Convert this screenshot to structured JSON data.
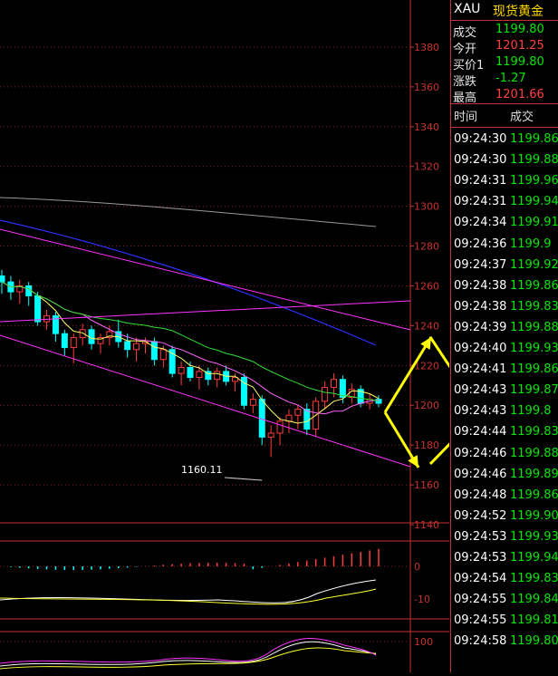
{
  "header": {
    "symbol": "XAU",
    "name": "现货黄金"
  },
  "quote": [
    {
      "label": "成交",
      "value": "1199.80",
      "color": "#00e600"
    },
    {
      "label": "今开",
      "value": "1201.25",
      "color": "#ff4040"
    },
    {
      "label": "买价1",
      "value": "1199.80",
      "color": "#00e600"
    },
    {
      "label": "涨跌",
      "value": "-1.27",
      "color": "#00e600"
    },
    {
      "label": "最高",
      "value": "1201.66",
      "color": "#ff4040"
    }
  ],
  "ticks_header": {
    "time": "时间",
    "price": "成交"
  },
  "ticks": [
    {
      "time": "09:24:30",
      "price": "1199.86"
    },
    {
      "time": "09:24:30",
      "price": "1199.88"
    },
    {
      "time": "09:24:31",
      "price": "1199.96"
    },
    {
      "time": "09:24:31",
      "price": "1199.94"
    },
    {
      "time": "09:24:34",
      "price": "1199.91"
    },
    {
      "time": "09:24:36",
      "price": "1199.9"
    },
    {
      "time": "09:24:37",
      "price": "1199.92"
    },
    {
      "time": "09:24:38",
      "price": "1199.86"
    },
    {
      "time": "09:24:38",
      "price": "1199.83"
    },
    {
      "time": "09:24:39",
      "price": "1199.88"
    },
    {
      "time": "09:24:40",
      "price": "1199.93"
    },
    {
      "time": "09:24:41",
      "price": "1199.86"
    },
    {
      "time": "09:24:43",
      "price": "1199.87"
    },
    {
      "time": "09:24:43",
      "price": "1199.8"
    },
    {
      "time": "09:24:44",
      "price": "1199.83"
    },
    {
      "time": "09:24:46",
      "price": "1199.88"
    },
    {
      "time": "09:24:46",
      "price": "1199.89"
    },
    {
      "time": "09:24:48",
      "price": "1199.86"
    },
    {
      "time": "09:24:52",
      "price": "1199.90"
    },
    {
      "time": "09:24:53",
      "price": "1199.93"
    },
    {
      "time": "09:24:53",
      "price": "1199.94"
    },
    {
      "time": "09:24:54",
      "price": "1199.83"
    },
    {
      "time": "09:24:55",
      "price": "1199.84"
    },
    {
      "time": "09:24:55",
      "price": "1199.81"
    },
    {
      "time": "09:24:58",
      "price": "1199.80"
    }
  ],
  "chart_data": {
    "type": "candlestick",
    "y_axis_labels": [
      "1380",
      "1360",
      "1340",
      "1320",
      "1300",
      "1280",
      "1260",
      "1240",
      "1220",
      "1200",
      "1180",
      "1160",
      "1140"
    ],
    "ylim": [
      1140,
      1390
    ],
    "low_annotation": "1160.11",
    "macd_axis_labels": [
      "0",
      "-10"
    ],
    "kdj_axis_labels": [
      "100"
    ],
    "colors": {
      "up": "#ff3c3c",
      "down": "#00ffff",
      "axis": "#c83232",
      "arrow": "#ffff00"
    },
    "candles": [
      [
        1265,
        1268,
        1256,
        1262
      ],
      [
        1262,
        1265,
        1253,
        1257
      ],
      [
        1257,
        1263,
        1251,
        1260
      ],
      [
        1260,
        1262,
        1250,
        1255
      ],
      [
        1255,
        1257,
        1240,
        1242
      ],
      [
        1242,
        1248,
        1238,
        1245
      ],
      [
        1245,
        1247,
        1232,
        1236
      ],
      [
        1236,
        1238,
        1225,
        1229
      ],
      [
        1229,
        1236,
        1221,
        1234
      ],
      [
        1234,
        1241,
        1230,
        1238
      ],
      [
        1238,
        1240,
        1228,
        1231
      ],
      [
        1231,
        1236,
        1226,
        1234
      ],
      [
        1234,
        1240,
        1230,
        1237
      ],
      [
        1237,
        1243,
        1229,
        1232
      ],
      [
        1232,
        1236,
        1224,
        1228
      ],
      [
        1228,
        1234,
        1222,
        1231
      ],
      [
        1231,
        1234,
        1226,
        1232
      ],
      [
        1232,
        1234,
        1220,
        1223
      ],
      [
        1223,
        1230,
        1219,
        1228
      ],
      [
        1228,
        1230,
        1214,
        1216
      ],
      [
        1216,
        1222,
        1210,
        1219
      ],
      [
        1219,
        1222,
        1212,
        1214
      ],
      [
        1214,
        1220,
        1208,
        1217
      ],
      [
        1217,
        1219,
        1210,
        1213
      ],
      [
        1213,
        1219,
        1209,
        1217
      ],
      [
        1217,
        1220,
        1210,
        1212
      ],
      [
        1212,
        1216,
        1207,
        1214
      ],
      [
        1214,
        1216,
        1198,
        1200
      ],
      [
        1200,
        1206,
        1196,
        1203
      ],
      [
        1203,
        1205,
        1180,
        1184
      ],
      [
        1184,
        1190,
        1174,
        1186
      ],
      [
        1186,
        1194,
        1180,
        1192
      ],
      [
        1192,
        1198,
        1186,
        1195
      ],
      [
        1195,
        1200,
        1188,
        1198
      ],
      [
        1198,
        1201,
        1185,
        1188
      ],
      [
        1188,
        1204,
        1184,
        1202
      ],
      [
        1202,
        1212,
        1198,
        1209
      ],
      [
        1209,
        1216,
        1204,
        1213
      ],
      [
        1213,
        1215,
        1201,
        1204
      ],
      [
        1204,
        1211,
        1201,
        1208
      ],
      [
        1208,
        1210,
        1199,
        1201
      ],
      [
        1201,
        1206,
        1198,
        1203
      ],
      [
        1203,
        1205,
        1199,
        1201
      ]
    ]
  }
}
